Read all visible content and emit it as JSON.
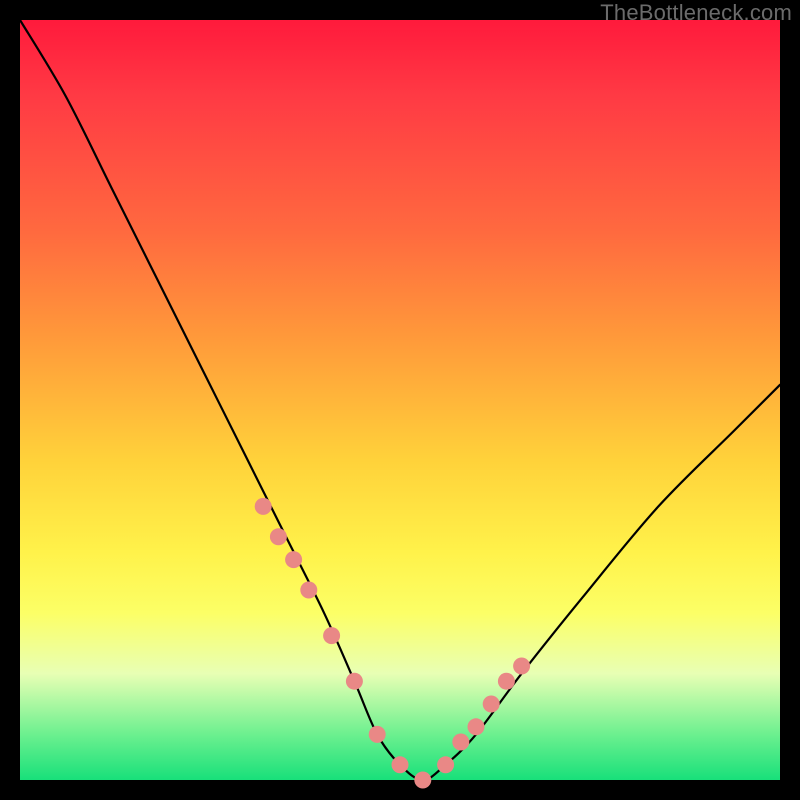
{
  "watermark": "TheBottleneck.com",
  "chart_data": {
    "type": "line",
    "title": "",
    "xlabel": "",
    "ylabel": "",
    "xlim": [
      0,
      100
    ],
    "ylim": [
      0,
      100
    ],
    "series": [
      {
        "name": "bottleneck-curve",
        "x": [
          0,
          6,
          12,
          18,
          24,
          30,
          35,
          40,
          44,
          47,
          50,
          53,
          56,
          60,
          66,
          74,
          84,
          94,
          100
        ],
        "values": [
          100,
          90,
          78,
          66,
          54,
          42,
          32,
          22,
          13,
          6,
          2,
          0,
          2,
          6,
          14,
          24,
          36,
          46,
          52
        ]
      }
    ],
    "markers": {
      "name": "highlight-points",
      "x": [
        32,
        34,
        36,
        38,
        41,
        44,
        47,
        50,
        53,
        56,
        58,
        60,
        62,
        64,
        66
      ],
      "values": [
        36,
        32,
        29,
        25,
        19,
        13,
        6,
        2,
        0,
        2,
        5,
        7,
        10,
        13,
        15
      ],
      "color": "#e98886"
    },
    "gradient_stops": [
      {
        "pos": 0.0,
        "color": "#ff1a3c"
      },
      {
        "pos": 0.28,
        "color": "#ff6a3f"
      },
      {
        "pos": 0.58,
        "color": "#ffd23a"
      },
      {
        "pos": 0.78,
        "color": "#fcff66"
      },
      {
        "pos": 1.0,
        "color": "#18e07a"
      }
    ]
  }
}
